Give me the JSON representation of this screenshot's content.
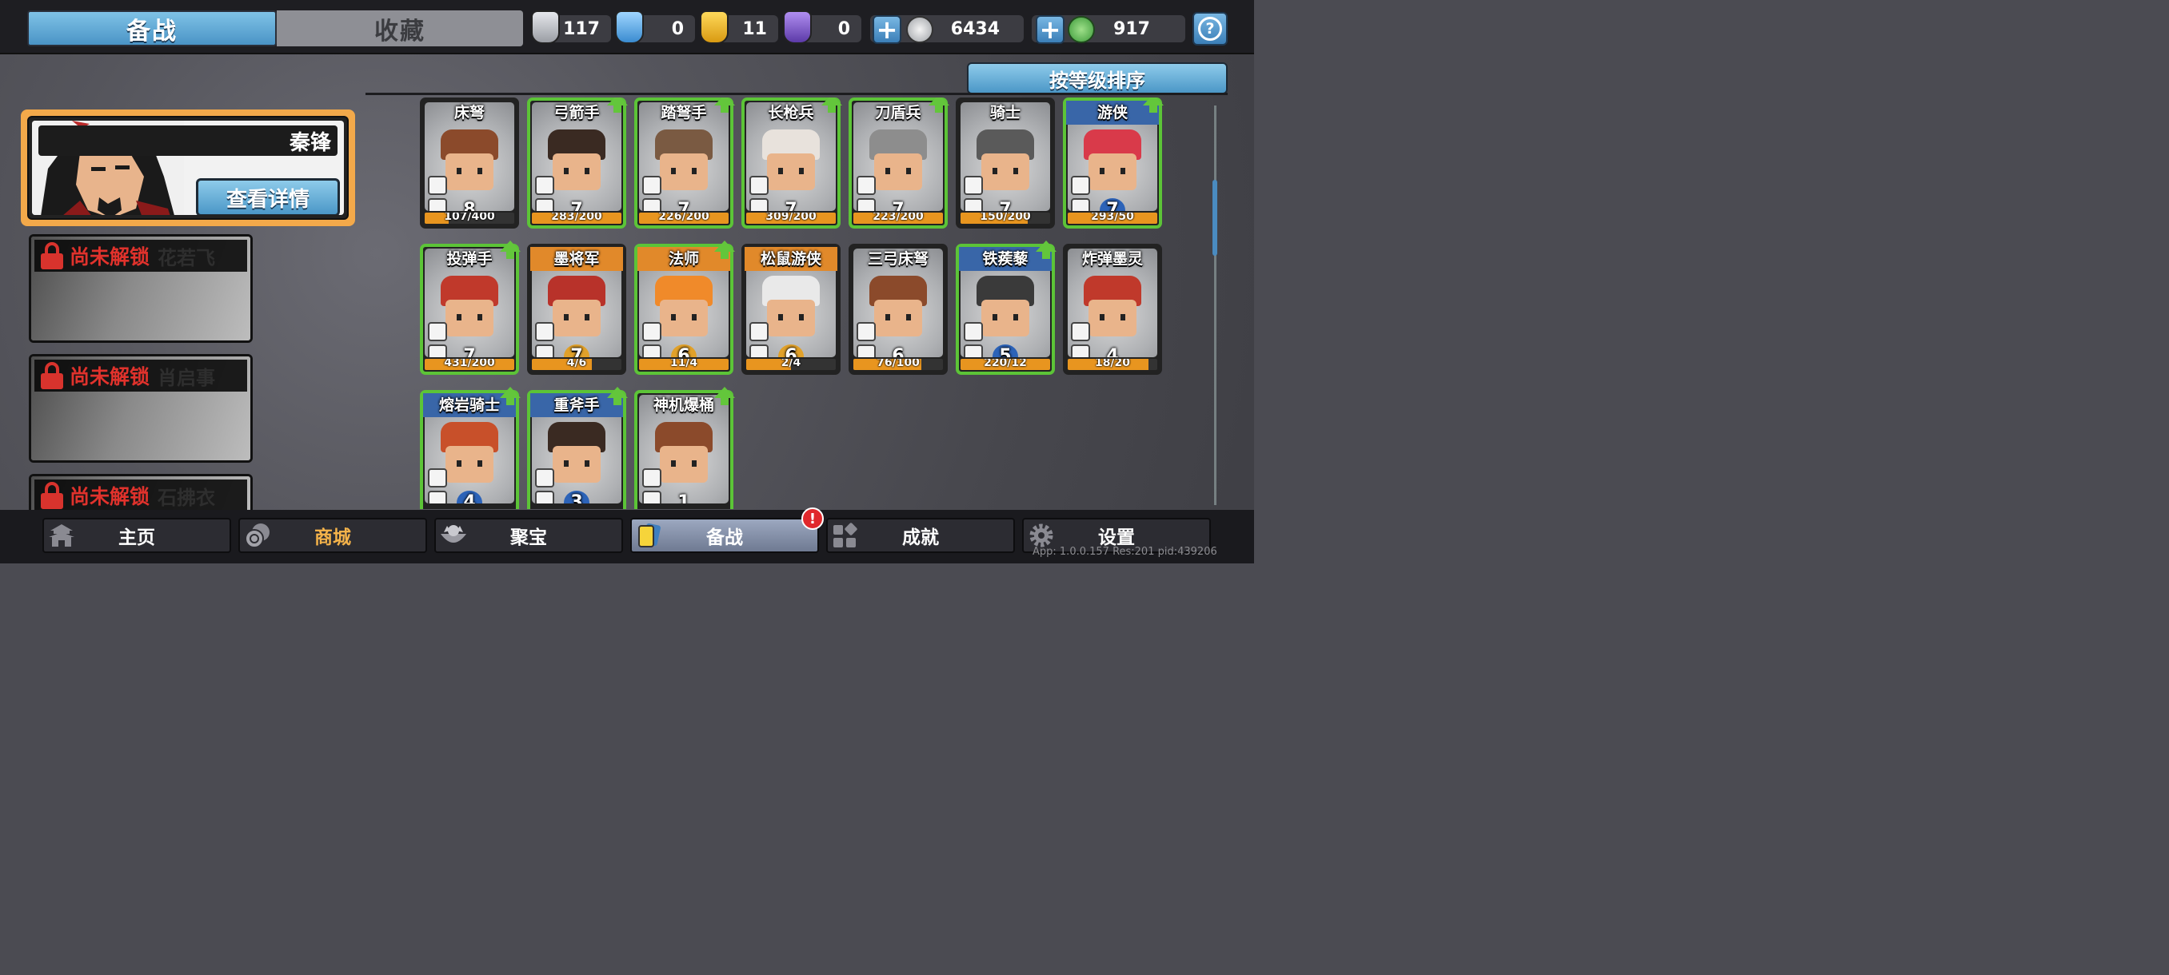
{
  "tabs": [
    {
      "label": "备战",
      "active": true
    },
    {
      "label": "收藏",
      "active": false
    }
  ],
  "resources": [
    {
      "icon": "silver-shield-icon",
      "value": "117",
      "color": "#b9bcc2"
    },
    {
      "icon": "blue-crystal-shield-icon",
      "value": "0",
      "color": "#56a7e2"
    },
    {
      "icon": "gold-shield-icon",
      "value": "11",
      "color": "#e7b52c"
    },
    {
      "icon": "purple-shield-icon",
      "value": "0",
      "color": "#7b55c8"
    }
  ],
  "currencies": [
    {
      "icon": "silver-coin-icon",
      "value": "6434",
      "color": "#d7d9dd"
    },
    {
      "icon": "jade-coin-icon",
      "value": "917",
      "color": "#5dbf4f"
    }
  ],
  "leader": {
    "name": "秦锋",
    "detail_button": "查看详情"
  },
  "locked_heroes": [
    {
      "status": "尚未解锁",
      "name": "花若飞"
    },
    {
      "status": "尚未解锁",
      "name": "肖启事"
    },
    {
      "status": "尚未解锁",
      "name": "石拂衣"
    }
  ],
  "sort_button": "按等级排序",
  "units": [
    {
      "name": "床弩",
      "level": "8",
      "progress": "107/400",
      "fill": 0.27,
      "upgrade": false,
      "rank": "none",
      "helm": "#8b4a2b",
      "icon1": "brick-icon",
      "icon2": "fist-icon"
    },
    {
      "name": "弓箭手",
      "level": "7",
      "progress": "283/200",
      "fill": 1.0,
      "upgrade": true,
      "rank": "none",
      "helm": "#3a2a22",
      "icon1": "swords-icon",
      "icon2": "helmet-icon"
    },
    {
      "name": "踏弩手",
      "level": "7",
      "progress": "226/200",
      "fill": 1.0,
      "upgrade": true,
      "rank": "none",
      "helm": "#7a5a42",
      "icon1": "swords-icon",
      "icon2": "fist-icon"
    },
    {
      "name": "长枪兵",
      "level": "7",
      "progress": "309/200",
      "fill": 1.0,
      "upgrade": true,
      "rank": "none",
      "helm": "#e8e2dc",
      "icon1": "sword-icon",
      "icon2": "wind-icon"
    },
    {
      "name": "刀盾兵",
      "level": "7",
      "progress": "223/200",
      "fill": 1.0,
      "upgrade": true,
      "rank": "none",
      "helm": "#8d8d8d",
      "icon1": "sword-icon",
      "icon2": "shield-icon"
    },
    {
      "name": "骑士",
      "level": "7",
      "progress": "150/200",
      "fill": 0.75,
      "upgrade": false,
      "rank": "none",
      "helm": "#5a5a5a",
      "icon1": "skull-icon",
      "icon2": "helmet-icon"
    },
    {
      "name": "游侠",
      "level": "7",
      "progress": "293/50",
      "fill": 1.0,
      "upgrade": true,
      "rank": "blue",
      "helm": "#d93a4a",
      "icon1": "skull-icon",
      "icon2": "horse-icon"
    },
    {
      "name": "投弹手",
      "level": "7",
      "progress": "431/200",
      "fill": 1.0,
      "upgrade": true,
      "rank": "none",
      "helm": "#c0392b",
      "icon1": "swords-icon",
      "icon2": "horse-icon"
    },
    {
      "name": "墨将军",
      "level": "7",
      "progress": "4/6",
      "fill": 0.67,
      "upgrade": false,
      "rank": "orange",
      "helm": "#b8322a",
      "icon1": "sword-icon",
      "icon2": "mask-icon"
    },
    {
      "name": "法师",
      "level": "6",
      "progress": "11/4",
      "fill": 1.0,
      "upgrade": true,
      "rank": "orange",
      "helm": "#f08a2a",
      "icon1": "skull-icon",
      "icon2": "helmet-icon"
    },
    {
      "name": "松鼠游侠",
      "level": "6",
      "progress": "2/4",
      "fill": 0.5,
      "upgrade": false,
      "rank": "orange",
      "helm": "#e9e9e9",
      "icon1": "skull-icon",
      "icon2": "wind-icon"
    },
    {
      "name": "三弓床弩",
      "level": "6",
      "progress": "76/100",
      "fill": 0.76,
      "upgrade": false,
      "rank": "none",
      "helm": "#8b4a2b",
      "icon1": "brick-icon",
      "icon2": "fist-icon"
    },
    {
      "name": "铁蒺藜",
      "level": "5",
      "progress": "220/12",
      "fill": 1.0,
      "upgrade": true,
      "rank": "blue",
      "helm": "#3a3a3a",
      "icon1": "spider-icon",
      "icon2": "wind-icon"
    },
    {
      "name": "炸弹墨灵",
      "level": "4",
      "progress": "18/20",
      "fill": 0.9,
      "upgrade": false,
      "rank": "none",
      "helm": "#c0392b",
      "icon1": "sword-icon",
      "icon2": "mask-icon"
    },
    {
      "name": "熔岩骑士",
      "level": "4",
      "progress": "",
      "fill": 0,
      "upgrade": true,
      "rank": "blue",
      "helm": "#c8502a",
      "icon1": "skull-icon",
      "icon2": "shield-icon"
    },
    {
      "name": "重斧手",
      "level": "3",
      "progress": "",
      "fill": 0,
      "upgrade": true,
      "rank": "blue",
      "helm": "#3a2a22",
      "icon1": "sword-icon",
      "icon2": "wind-icon"
    },
    {
      "name": "神机爆桶",
      "level": "1",
      "progress": "",
      "fill": 0,
      "upgrade": true,
      "rank": "none",
      "helm": "#8b4a2b",
      "icon1": "spider-icon",
      "icon2": "sun-icon"
    }
  ],
  "nav": [
    {
      "label": "主页",
      "icon": "pagoda-icon"
    },
    {
      "label": "商城",
      "icon": "coins-icon"
    },
    {
      "label": "聚宝",
      "icon": "treasure-bowl-icon"
    },
    {
      "label": "备战",
      "icon": "cards-icon",
      "active": true,
      "alert": "!"
    },
    {
      "label": "成就",
      "icon": "grid-icon"
    },
    {
      "label": "设置",
      "icon": "gear-icon"
    }
  ],
  "build_info": "App: 1.0.0.157 Res:201 pid:439206"
}
